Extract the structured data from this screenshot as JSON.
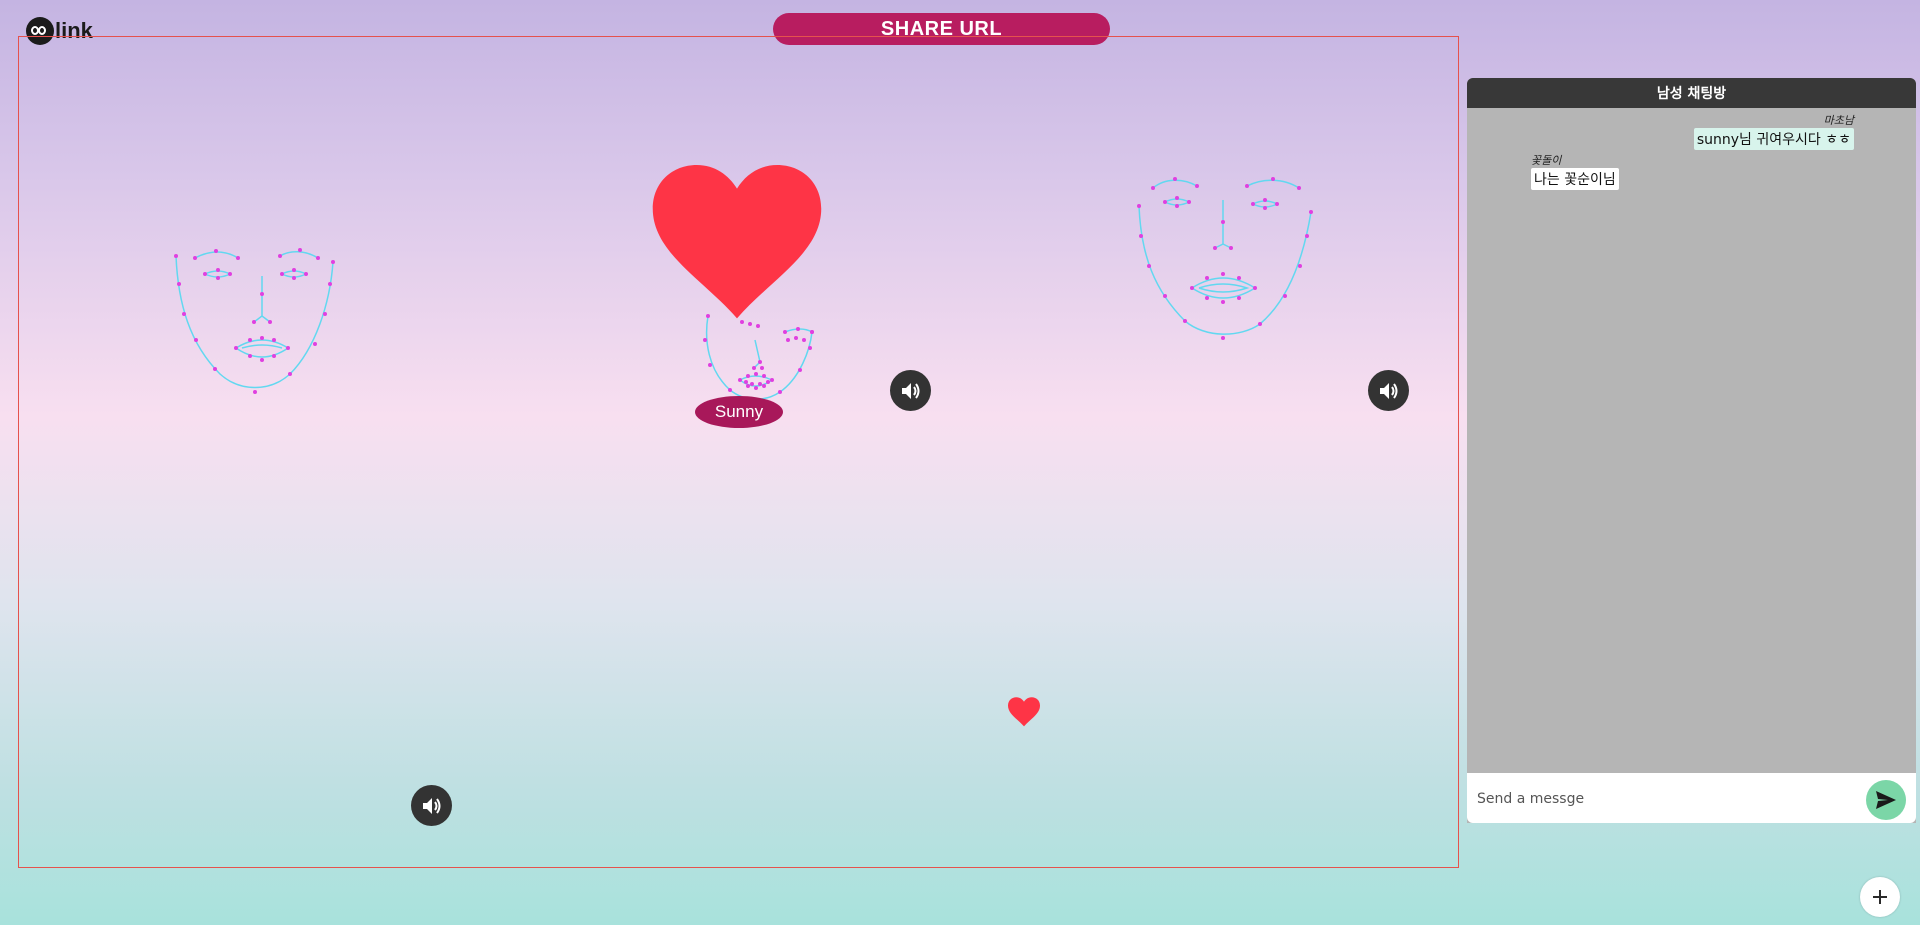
{
  "app": {
    "logo_text": "link"
  },
  "header": {
    "share_label": "SHARE URL"
  },
  "stage": {
    "participant_name": "Sunny"
  },
  "chat": {
    "title": "남성 채팅방",
    "messages": [
      {
        "sender": "마초남",
        "text": "sunny님 귀여우시다 ㅎㅎ",
        "align": "right"
      },
      {
        "sender": "꽃돌이",
        "text": "나는 꽃순이님",
        "align": "left"
      }
    ],
    "input_placeholder": "Send a messge"
  },
  "icons": {
    "speaker": "volume-icon",
    "send": "send-icon",
    "add": "plus-icon",
    "heart": "heart-icon"
  },
  "colors": {
    "accent": "#b81d60",
    "heart": "#fe3446",
    "send": "#7bd6a7",
    "chat_header": "#383838",
    "chat_body": "#b5b5b5",
    "face_outline": "#62d8f0",
    "face_points": "#e040e0"
  }
}
